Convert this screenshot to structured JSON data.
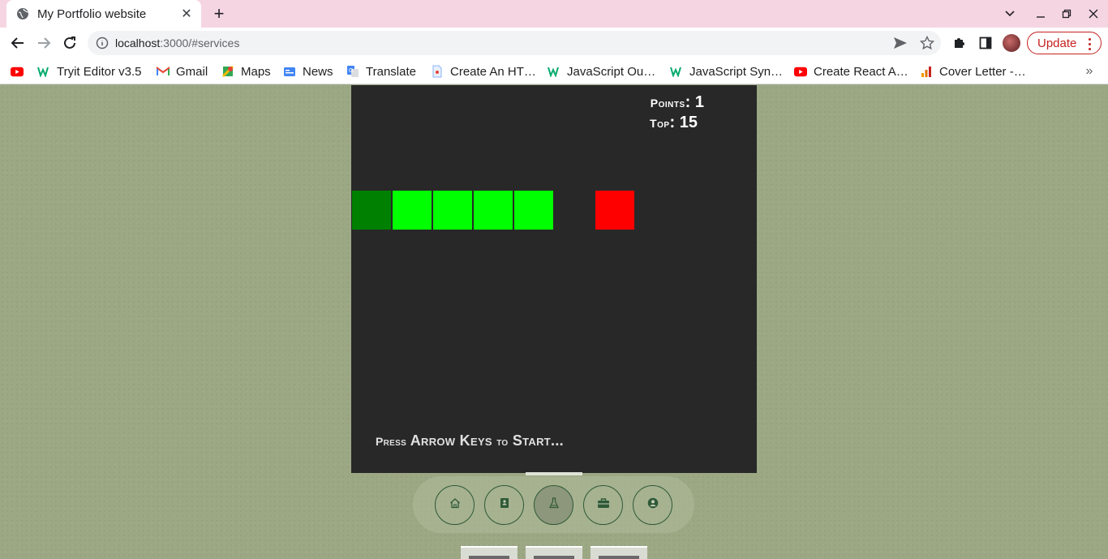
{
  "browser": {
    "tab_title": "My Portfolio website",
    "url_host": "localhost",
    "url_path": ":3000/#services",
    "update_label": "Update",
    "bookmarks": [
      {
        "label": "",
        "icon": "youtube-icon"
      },
      {
        "label": "Tryit Editor v3.5",
        "icon": "w3schools-icon"
      },
      {
        "label": "Gmail",
        "icon": "gmail-icon"
      },
      {
        "label": "Maps",
        "icon": "maps-icon"
      },
      {
        "label": "News",
        "icon": "news-icon"
      },
      {
        "label": "Translate",
        "icon": "translate-icon"
      },
      {
        "label": "Create An HT…",
        "icon": "page-icon"
      },
      {
        "label": "JavaScript Ou…",
        "icon": "w3schools-icon"
      },
      {
        "label": "JavaScript Syn…",
        "icon": "w3schools-icon"
      },
      {
        "label": "Create React A…",
        "icon": "youtube-icon"
      },
      {
        "label": "Cover Letter -…",
        "icon": "chart-icon"
      }
    ]
  },
  "game": {
    "points_label": "Points",
    "points_value": "1",
    "top_label": "Top",
    "top_value": "15",
    "press_small_1": "Press",
    "press_big_1": "Arrow Keys",
    "press_small_2": "to",
    "press_big_2": "Start...",
    "colors": {
      "board": "#282828",
      "snake_head": "#008000",
      "snake_body": "#00ff00",
      "food": "#ff0000"
    }
  },
  "nav": {
    "items": [
      {
        "icon": "home-icon"
      },
      {
        "icon": "book-icon"
      },
      {
        "icon": "flask-icon",
        "active": true
      },
      {
        "icon": "briefcase-icon"
      },
      {
        "icon": "user-circle-icon"
      }
    ]
  }
}
